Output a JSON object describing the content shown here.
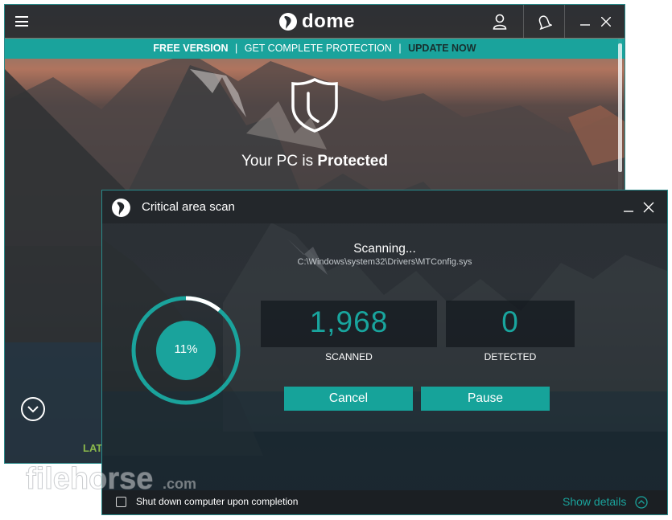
{
  "main_window": {
    "logo_text": "dome",
    "banner": {
      "free_version": "FREE VERSION",
      "sep": "|",
      "get_complete": "GET COMPLETE PROTECTION",
      "update_now": "UPDATE NOW"
    },
    "status_prefix": "Your PC is",
    "status_value": "Protected",
    "partial_label": "LAT"
  },
  "scan_dialog": {
    "title": "Critical area scan",
    "scanning_label": "Scanning...",
    "current_path": "C:\\Windows\\system32\\Drivers\\MTConfig.sys",
    "progress_percent": 11,
    "progress_label": "11%",
    "scanned_value": "1,968",
    "scanned_label": "SCANNED",
    "detected_value": "0",
    "detected_label": "DETECTED",
    "cancel_label": "Cancel",
    "pause_label": "Pause",
    "shutdown_checked": false,
    "shutdown_label": "Shut down computer upon completion",
    "show_details_label": "Show details"
  },
  "watermark": {
    "brand": "filehorse",
    "suffix": ".com"
  },
  "colors": {
    "accent": "#1aa39c",
    "banner_bg": "#1aa39c",
    "progress_ring": "#1aa39c",
    "partial_label": "#8ab84b"
  },
  "icons": {
    "menu": "hamburger-icon",
    "account": "user-icon",
    "notifications": "bell-icon",
    "minimize": "minimize-icon",
    "close": "close-icon",
    "shield": "shield-icon",
    "scroll_down": "chevron-down-circle-icon",
    "details": "chevron-up-circle-icon"
  }
}
